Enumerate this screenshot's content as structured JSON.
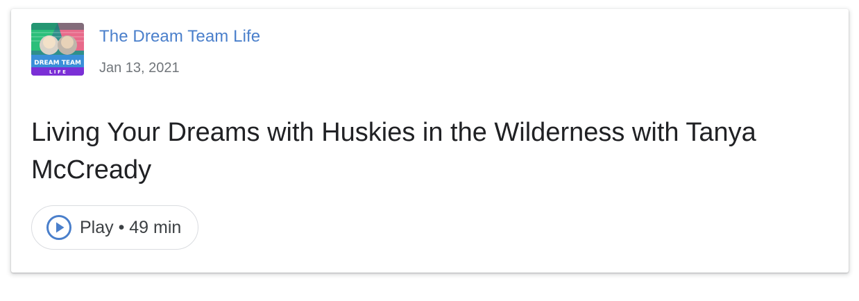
{
  "episode": {
    "show_name": "The Dream Team Life",
    "date": "Jan 13, 2021",
    "title": "Living Your Dreams with Huskies in the Wilderness with Tanya McCready",
    "play_label": "Play • 49 min",
    "thumbnail_text": {
      "line1": "DREAM TEAM",
      "line2": "L I F E"
    }
  },
  "icons": {
    "play": "play-circle-icon"
  },
  "colors": {
    "show_name": "#4a7fcb",
    "play_icon": "#4a7fcb",
    "title_text": "#202124",
    "date_text": "#70757a"
  }
}
